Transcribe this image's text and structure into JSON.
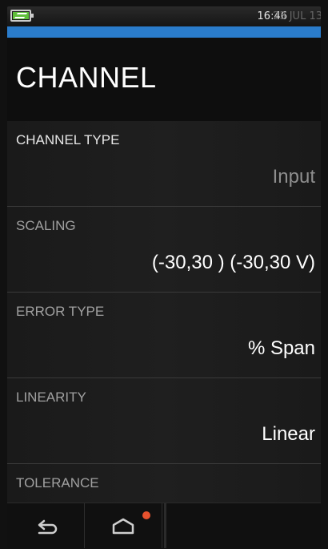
{
  "status": {
    "time": "16:46",
    "date": "23 JUL 13",
    "battery_icon": "battery-charging-icon",
    "battery_color": "#5fbf3a",
    "accent_color": "#2a7ccb"
  },
  "header": {
    "title": "CHANNEL"
  },
  "settings": [
    {
      "label": "CHANNEL TYPE",
      "value": "Input"
    },
    {
      "label": "SCALING",
      "value": "(-30,30 ) (-30,30 V)"
    },
    {
      "label": "ERROR TYPE",
      "value": "% Span"
    },
    {
      "label": "LINEARITY",
      "value": "Linear"
    },
    {
      "label": "TOLERANCE",
      "value": ""
    }
  ],
  "navbar": {
    "back_icon": "back-arrow-icon",
    "home_icon": "home-icon",
    "notification_color": "#e8522e"
  }
}
